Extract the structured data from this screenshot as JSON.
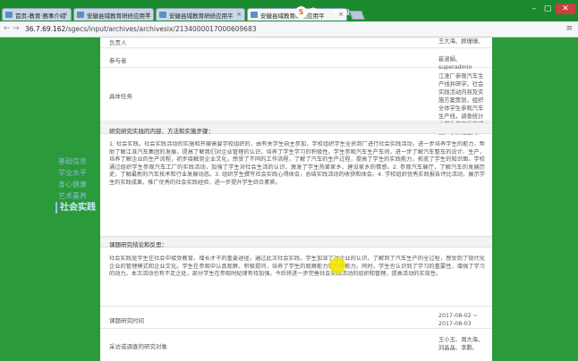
{
  "browser": {
    "tabs": [
      {
        "label": "首页-教育·赛事介绍"
      },
      {
        "label": "安徽县域教育研修应用平"
      },
      {
        "label": "安徽县域教育研修应用平"
      },
      {
        "label": "安徽县域教育研修应用平"
      }
    ],
    "extension_labels": [
      "S",
      "中",
      "设"
    ],
    "url_host": "36.7.69.162",
    "url_path": "/sgecs/input/archives/archivesix/2134000017000609683",
    "back_icon": "back-arrow-icon",
    "forward_icon": "forward-arrow-icon"
  },
  "sidebar": {
    "items": [
      {
        "label": "基础信息"
      },
      {
        "label": "学业水平"
      },
      {
        "label": "身心健康"
      },
      {
        "label": "艺术素养"
      },
      {
        "label": "社会实践"
      }
    ]
  },
  "record": {
    "row1_label": "负责人",
    "row1_value": "王大海、顾珊珊、",
    "row2_label": "参与者",
    "row2_value": "崔淑娟、superadmin",
    "row3_label": "具体任务",
    "row3_value": "江淮厂参观汽车生产线并研学。社会实践活动内容及实施方案策划，组织全体学生参观汽车生产线，调查统计文学生参观后的感受，了解社会的",
    "section1_title": "研究研究实践的内容、方法和实施步骤：",
    "section1_text": "1. 社会实践。社会实践活动的实施和开展需要学校组织的，由有关学生自主参加，学校组织学生全员到厂进行社会实践活动，进一步培养学生的能力，帮助了解江淮汽车集团的发展，提高了解我们对企业管理的认识，培养了学生学习的积极性。学生参观汽车生产车间，进一步了解汽车整车的设计、生产，培养了解企业的生产流程，初步接触到企业文化，感受了不同的工作流程，了解了汽车的生产过程，提高了学生的实践能力，拓宽了学生的知识面。学校通过组织学生参观汽车工厂的实践活动，加强了学生对社会生活的认识，激发了学生热爱家乡、建设家乡的情感。2. 参观汽车展厅，了解汽车的发展历史，了解最新的汽车技术和行业发展动态。3. 组织学生撰写社会实践心得体会，总结实践活动的收获和体会。4. 学校组织优秀实践报告评比活动，展示学生的实践成果，推广优秀的社会实践经验，进一步提升学生综合素质。",
    "section2_title": "课题研究结论和反思：",
    "section2_text": "社会实践是学生在社会中接受教育、增长才干的重要途径，通过此次社会实践，学生加深了对企业的认识，了解到了汽车生产的全过程，感受到了现代化企业的管理模式和企业文化。学生在参观中认真观察、积极提问，培养了学生的观察能力和思考能力。同时，学生也认识到了学习的重要性，增强了学习的动力。本次活动也有不足之处，部分学生在参观时纪律有待加强，今后将进一步完善社会实践活动的组织和管理，提高活动的实效性。",
    "row4_label": "课题研究时间",
    "row4_value": "2017-08-02 ~ 2017-08-03",
    "row5_label": "采访或调查的研究对象",
    "row5_value": "王小玉、周大海、刘晶晶、李鹏、",
    "cursor_icon": "cursor-highlight-icon"
  },
  "colors": {
    "background": "#2a9a3a",
    "sidebar_text": "#8fb8d8",
    "page": "#ffffff"
  }
}
